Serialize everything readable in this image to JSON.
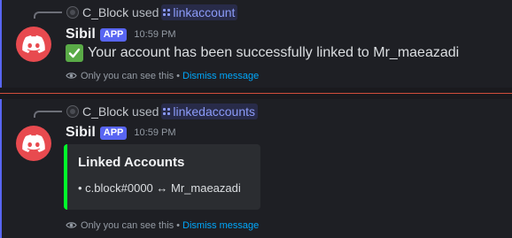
{
  "messages": [
    {
      "reply": {
        "user": "C_Block",
        "used_text": "used",
        "command": "linkaccount"
      },
      "author": "Sibil",
      "tag": "APP",
      "time": "10:59 PM",
      "content": "Your account has been successfully linked to Mr_maeazadi",
      "ephemeral_note": "Only you can see this",
      "separator": "•",
      "dismiss_label": "Dismiss message"
    },
    {
      "reply": {
        "user": "C_Block",
        "used_text": "used",
        "command": "linkedaccounts"
      },
      "author": "Sibil",
      "tag": "APP",
      "time": "10:59 PM",
      "embed": {
        "title": "Linked Accounts",
        "description": "• c.block#0000 ↔ Mr_maeazadi",
        "color": "#00ff2b"
      },
      "ephemeral_note": "Only you can see this",
      "separator": "•",
      "dismiss_label": "Dismiss message"
    }
  ],
  "colors": {
    "accent": "#5865f2",
    "avatar_bg": "#e84a4f",
    "link": "#00a8fc",
    "new_divider": "#d14e3b",
    "check_bg": "#5aab47"
  }
}
